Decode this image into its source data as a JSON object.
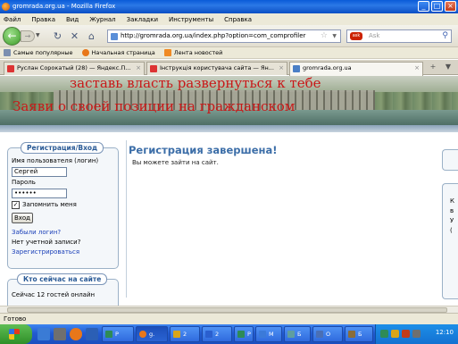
{
  "window": {
    "title": "gromrada.org.ua - Mozilla Firefox",
    "controls": [
      "_",
      "□",
      "×"
    ]
  },
  "menu": [
    "Файл",
    "Правка",
    "Вид",
    "Журнал",
    "Закладки",
    "Инструменты",
    "Справка"
  ],
  "nav": {
    "url": "http://gromrada.org.ua/index.php?option=com_comprofiler",
    "search_placeholder": "Ask",
    "search_engine": "ask",
    "back_icon": "back-arrow-icon",
    "forward_icon": "forward-arrow-icon"
  },
  "bookmarks": [
    "Самые популярные",
    "Начальная страница",
    "Лента новостей"
  ],
  "tabs": [
    {
      "label": "Руслан Сорокатый (28) — Яндекс.П...",
      "active": false
    },
    {
      "label": "Інструкція користувача сайта — Ян...",
      "active": false
    },
    {
      "label": "gromrada.org.ua",
      "active": true
    }
  ],
  "banner": {
    "line1": "заставь власть развернуться к тебе",
    "line2": "Заяви о своей позиции на гражданском"
  },
  "login": {
    "title": "Регистрация/Вход",
    "username_label": "Имя пользователя (логин)",
    "username_value": "Сергей",
    "password_label": "Пароль",
    "password_value": "••••••",
    "remember_label": "Запомнить меня",
    "remember_checked": true,
    "submit_label": "Вход",
    "forgot_link": "Забыли логин?",
    "no_account_text": "Нет учетной записи?",
    "register_link": "Зарегистрироваться"
  },
  "who_online": {
    "title": "Кто сейчас на сайте",
    "text": "Сейчас 12 гостей онлайн"
  },
  "main": {
    "title": "Регистрация завершена!",
    "message": "Вы можете зайти на сайт."
  },
  "right_panel_letters": [
    "К",
    "в",
    "У",
    "("
  ],
  "status": "Готово",
  "taskbar": {
    "tasks": [
      {
        "label": "Р",
        "color": "#2e8b57"
      },
      {
        "label": "g.",
        "color": "#e8771a"
      },
      {
        "label": "2",
        "color": "#d9a51a"
      },
      {
        "label": "2",
        "color": "#2a5fcf"
      },
      {
        "label": "Р",
        "color": "#2e8b57"
      },
      {
        "label": "М",
        "color": "#3b7ad9"
      },
      {
        "label": "Б",
        "color": "#5f9ea0"
      },
      {
        "label": "О",
        "color": "#4a6fb5"
      },
      {
        "label": "Б",
        "color": "#8a6d3b"
      }
    ],
    "clock": "12:10",
    "tray_lang": "RU"
  }
}
